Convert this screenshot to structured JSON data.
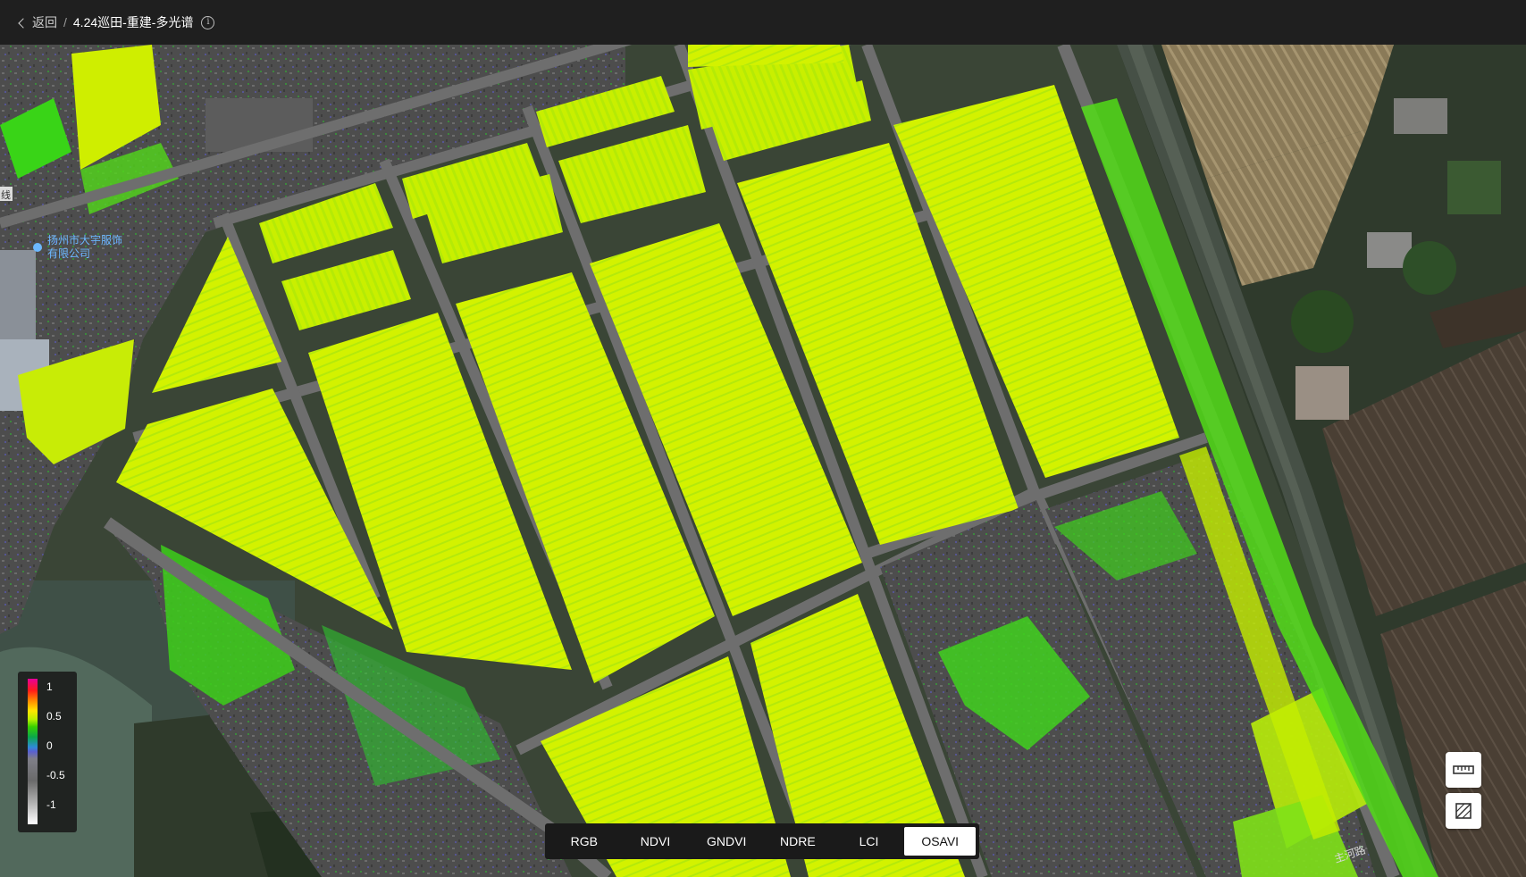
{
  "header": {
    "back_label": "返回",
    "separator": "/",
    "title": "4.24巡田-重建-多光谱"
  },
  "map": {
    "poi_label_line1": "扬州市大宇服饰",
    "poi_label_line2": "有限公司",
    "road_label": "主河路",
    "edge_label": "线"
  },
  "legend": {
    "ticks": [
      "1",
      "0.5",
      "0",
      "-0.5",
      "-1"
    ]
  },
  "bands": {
    "items": [
      "RGB",
      "NDVI",
      "GNDVI",
      "NDRE",
      "LCI",
      "OSAVI"
    ],
    "selected": "OSAVI"
  },
  "tools": {
    "ruler_icon": "ruler-icon",
    "area_icon": "polygon-measure-icon"
  },
  "colors": {
    "crop_high": "#d6f000",
    "crop_mid": "#8ee81a",
    "road": "#6e6e6e",
    "bare_soil": "#555555",
    "water": "#3a4a3a"
  }
}
